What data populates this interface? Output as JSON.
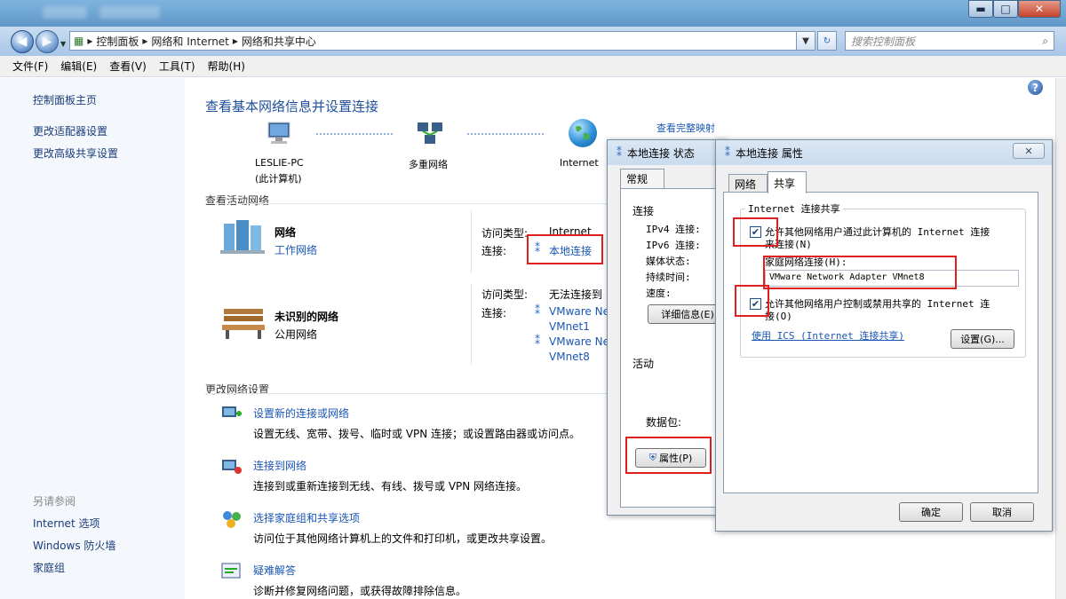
{
  "window": {
    "minimize": "▬",
    "maximize": "□",
    "close": "✕"
  },
  "nav": {
    "back": "◀",
    "forward": "▶",
    "breadcrumb": [
      "控制面板",
      "网络和 Internet",
      "网络和共享中心"
    ],
    "search_placeholder": "搜索控制面板"
  },
  "menu": [
    "文件(F)",
    "编辑(E)",
    "查看(V)",
    "工具(T)",
    "帮助(H)"
  ],
  "sidebar": {
    "top": [
      "控制面板主页",
      "更改适配器设置",
      "更改高级共享设置"
    ],
    "see_also_title": "另请参阅",
    "see_also": [
      "Internet 选项",
      "Windows 防火墙",
      "家庭组"
    ]
  },
  "main": {
    "title": "查看基本网络信息并设置连接",
    "map_link": "查看完整映射",
    "nodes": [
      {
        "label": "LESLIE-PC",
        "sub": "(此计算机)"
      },
      {
        "label": "多重网络",
        "sub": ""
      },
      {
        "label": "Internet",
        "sub": ""
      }
    ],
    "active_title": "查看活动网络",
    "networks": [
      {
        "name": "网络",
        "type": "工作网络",
        "access_label": "访问类型:",
        "access_value": "Internet",
        "conn_label": "连接:",
        "conns": [
          "本地连接"
        ]
      },
      {
        "name": "未识别的网络",
        "type": "公用网络",
        "access_label": "访问类型:",
        "access_value": "无法连接到",
        "conn_label": "连接:",
        "conns": [
          "VMware Ne",
          "VMnet1",
          "VMware Ne",
          "VMnet8"
        ]
      }
    ],
    "change_title": "更改网络设置",
    "tasks": [
      {
        "link": "设置新的连接或网络",
        "desc": "设置无线、宽带、拨号、临时或 VPN 连接；或设置路由器或访问点。"
      },
      {
        "link": "连接到网络",
        "desc": "连接到或重新连接到无线、有线、拨号或 VPN 网络连接。"
      },
      {
        "link": "选择家庭组和共享选项",
        "desc": "访问位于其他网络计算机上的文件和打印机，或更改共享设置。"
      },
      {
        "link": "疑难解答",
        "desc": "诊断并修复网络问题，或获得故障排除信息。"
      }
    ]
  },
  "status_dialog": {
    "title": "本地连接 状态",
    "tab": "常规",
    "conn_title": "连接",
    "rows": [
      "IPv4 连接:",
      "IPv6 连接:",
      "媒体状态:",
      "持续时间:",
      "速度:"
    ],
    "details_btn": "详细信息(E)",
    "activity_title": "活动",
    "packets_label": "数据包:",
    "props_btn": "属性(P)"
  },
  "props_dialog": {
    "title": "本地连接 属性",
    "close": "✕",
    "tabs": [
      "网络",
      "共享"
    ],
    "group_title": "Internet 连接共享",
    "check1_line1": "允许其他网络用户通过此计算机的 Internet 连接",
    "check1_line2": "来连接(N)",
    "home_label": "家庭网络连接(H):",
    "home_value": "VMware Network Adapter VMnet8",
    "check2_line1": "允许其他网络用户控制或禁用共享的 Internet 连",
    "check2_line2": "接(O)",
    "ics_link": "使用 ICS (Internet 连接共享)",
    "settings_btn": "设置(G)...",
    "ok": "确定",
    "cancel": "取消"
  },
  "colors": {
    "accent": "#1a56b4",
    "title": "#1e4f9a",
    "highlight": "#e02020",
    "sidebar_bg": "#f4f8fd"
  }
}
